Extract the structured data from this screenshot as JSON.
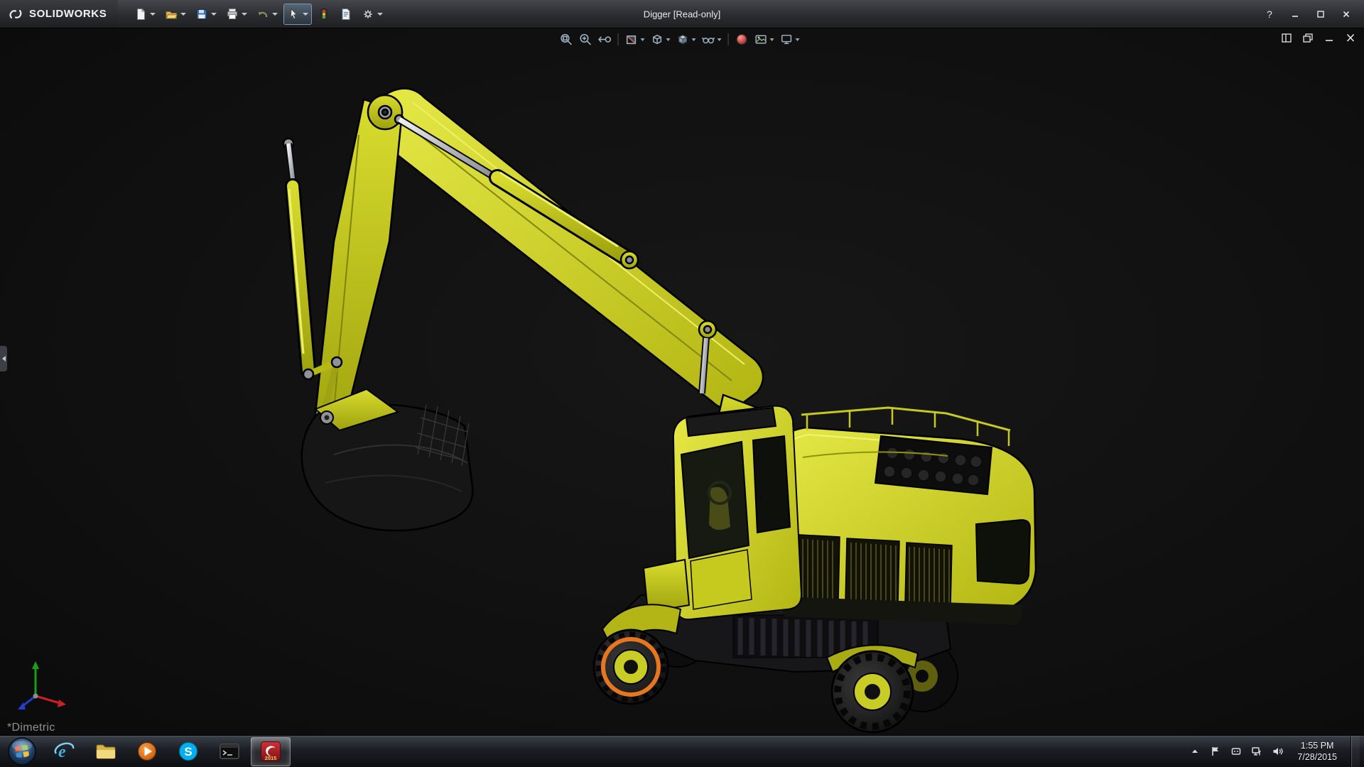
{
  "titlebar": {
    "brand": "SOLIDWORKS",
    "title": "Digger [Read-only]",
    "help_label": "?",
    "tools": [
      "new-document",
      "open",
      "save",
      "print",
      "undo",
      "select",
      "rebuild",
      "file-properties",
      "options"
    ],
    "window_controls": [
      "help",
      "minimize",
      "maximize",
      "close"
    ]
  },
  "headsup_toolbar": {
    "tools": [
      "zoom-to-fit",
      "zoom-to-area",
      "previous-view",
      "section-view",
      "view-orientation",
      "display-style",
      "hide-show-items",
      "edit-appearance",
      "apply-scene",
      "view-settings"
    ]
  },
  "document_window": {
    "controls": [
      "tile",
      "restore",
      "minimize",
      "close"
    ]
  },
  "viewport": {
    "orientation_label": "*Dimetric",
    "background_color": "#121212",
    "model": {
      "name": "Digger excavator",
      "body_color": "#d6d829",
      "selection_highlight_color": "#e8761e"
    },
    "triad_axis_colors": {
      "x": "#cc2020",
      "y": "#18a018",
      "z": "#2040cc"
    }
  },
  "taskbar": {
    "apps": [
      "start",
      "internet-explorer",
      "windows-explorer",
      "media-player",
      "skype",
      "command-prompt",
      "solidworks-2015"
    ],
    "ie_letter": "e",
    "skype_letter": "S",
    "sw_year": "2015",
    "tray_icons": [
      "hidden-icons",
      "action-center-flag",
      "device",
      "network",
      "volume"
    ],
    "time": "1:55 PM",
    "date": "7/28/2015"
  }
}
